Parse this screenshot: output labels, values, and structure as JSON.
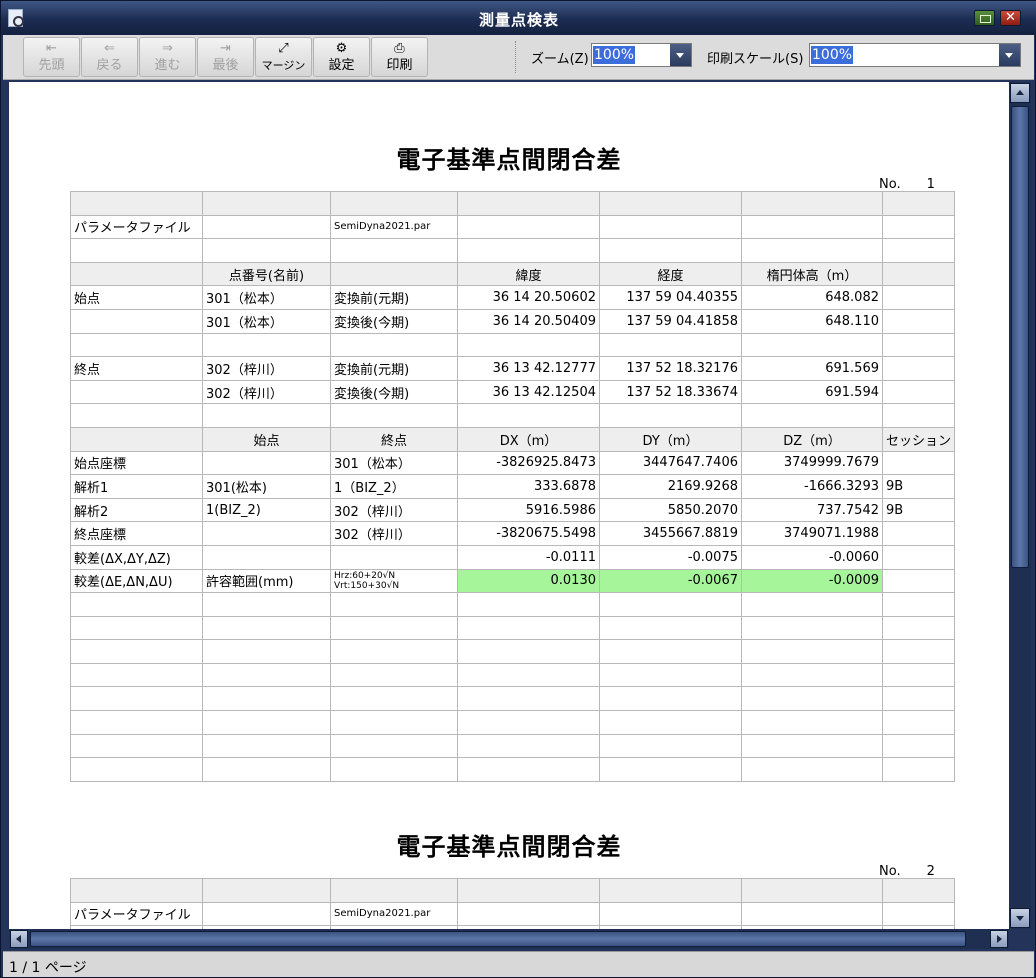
{
  "window": {
    "title": "測量点検表"
  },
  "toolbar": {
    "buttons": [
      {
        "label": "先頭",
        "icon": "⇤"
      },
      {
        "label": "戻る",
        "icon": "⇐"
      },
      {
        "label": "進む",
        "icon": "⇒"
      },
      {
        "label": "最後",
        "icon": "⇥"
      },
      {
        "label": "マージン",
        "icon": "⤢"
      },
      {
        "label": "設定",
        "icon": "⚙"
      },
      {
        "label": "印刷",
        "icon": "⎙"
      }
    ],
    "zoom_label": "ズーム(Z)",
    "zoom_value": "100%",
    "print_scale_label": "印刷スケール(S)",
    "print_scale_value": "100%"
  },
  "status": {
    "pages": "1 / 1 ページ"
  },
  "report": {
    "title": "電子基準点間閉合差",
    "page1_no": "No.　　1",
    "page2_no": "No.　　2",
    "param_label": "パラメータファイル",
    "param_file": "SemiDyna2021.par",
    "header1": {
      "point": "点番号(名前)",
      "lat": "緯度",
      "lon": "経度",
      "height": "楕円体高（m）"
    },
    "start_label": "始点",
    "end_label": "終点",
    "start_rows": [
      {
        "point": "301（松本）",
        "phase": "変換前(元期)",
        "lat": "36 14 20.50602",
        "lon": "137 59 04.40355",
        "height": "648.082"
      },
      {
        "point": "301（松本）",
        "phase": "変換後(今期)",
        "lat": "36 14 20.50409",
        "lon": "137 59 04.41858",
        "height": "648.110"
      }
    ],
    "end_rows": [
      {
        "point": "302（梓川）",
        "phase": "変換前(元期)",
        "lat": "36 13 42.12777",
        "lon": "137 52 18.32176",
        "height": "691.569"
      },
      {
        "point": "302（梓川）",
        "phase": "変換後(今期)",
        "lat": "36 13 42.12504",
        "lon": "137 52 18.33674",
        "height": "691.594"
      }
    ],
    "header2": {
      "from": "始点",
      "to": "終点",
      "dx": "DX（m）",
      "dy": "DY（m）",
      "dz": "DZ（m）",
      "session": "セッション"
    },
    "vec_rows": [
      {
        "label": "始点座標",
        "from": "",
        "to": "301（松本）",
        "dx": "-3826925.8473",
        "dy": "3447647.7406",
        "dz": "3749999.7679",
        "session": ""
      },
      {
        "label": "解析1",
        "from": "301(松本)",
        "to": "1（BIZ_2）",
        "dx": "333.6878",
        "dy": "2169.9268",
        "dz": "-1666.3293",
        "session": "9B"
      },
      {
        "label": "解析2",
        "from": "1(BIZ_2)",
        "to": "302（梓川）",
        "dx": "5916.5986",
        "dy": "5850.2070",
        "dz": "737.7542",
        "session": "9B"
      },
      {
        "label": "終点座標",
        "from": "",
        "to": "302（梓川）",
        "dx": "-3820675.5498",
        "dy": "3455667.8819",
        "dz": "3749071.1988",
        "session": ""
      },
      {
        "label": "較差(ΔX,ΔY,ΔZ)",
        "from": "",
        "to": "",
        "dx": "-0.0111",
        "dy": "-0.0075",
        "dz": "-0.0060",
        "session": ""
      }
    ],
    "enu_row": {
      "label": "較差(ΔE,ΔN,ΔU)",
      "tolerance_label": "許容範囲(mm)",
      "hrz": "Hrz:60+20√N",
      "vrt": "Vrt:150+30√N",
      "de": "0.0130",
      "dn": "-0.0067",
      "du": "-0.0009"
    }
  },
  "colors": {
    "highlight": "#a6f59a",
    "header_fill": "#eeeeee",
    "title_bar": "#1c2c52"
  }
}
